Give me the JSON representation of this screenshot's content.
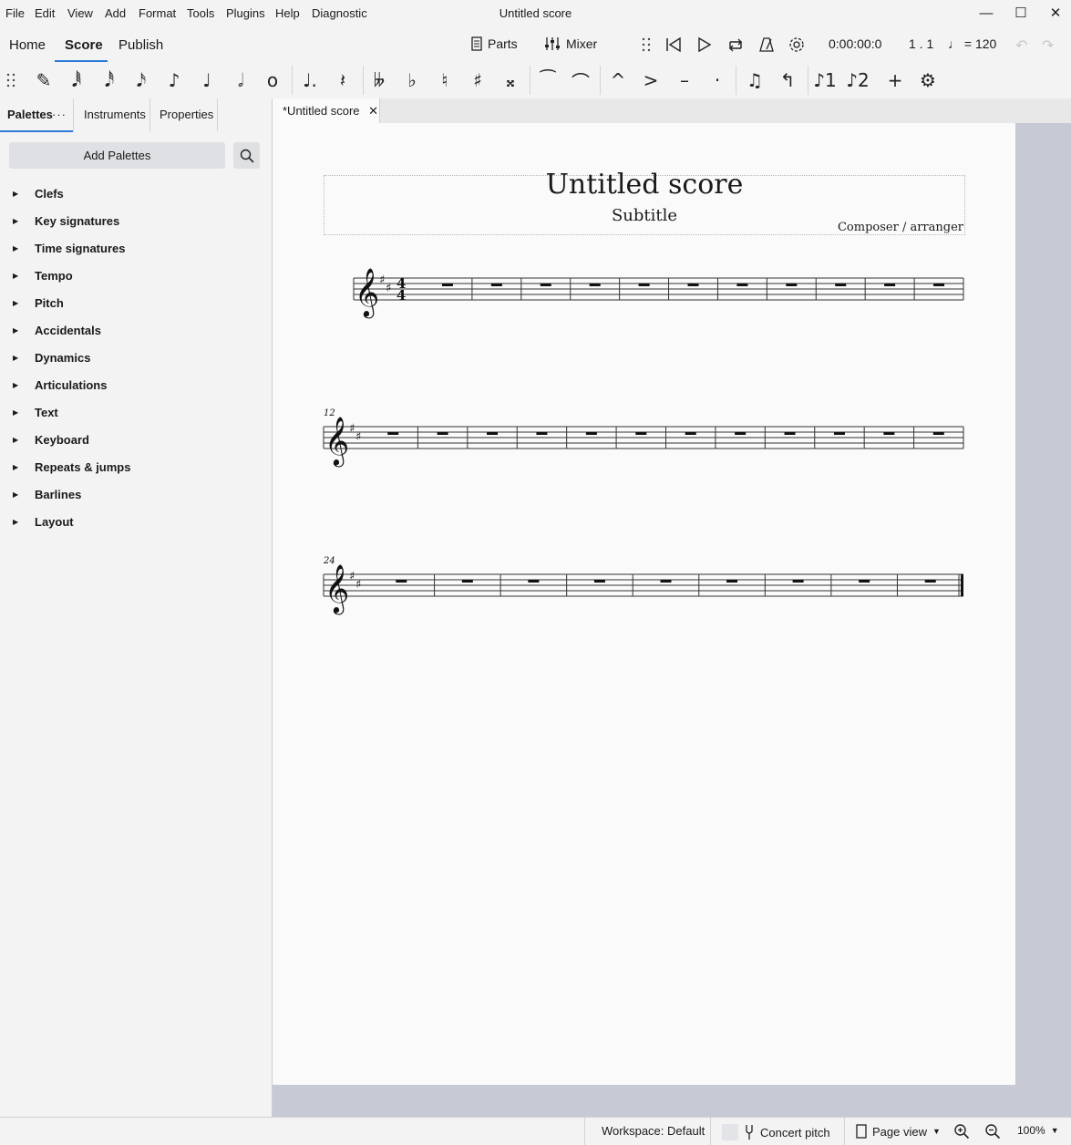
{
  "menu": [
    "File",
    "Edit",
    "View",
    "Add",
    "Format",
    "Tools",
    "Plugins",
    "Help",
    "Diagnostic"
  ],
  "window_title": "Untitled score",
  "window_controls": {
    "minimize": "—",
    "maximize": "☐",
    "close": "✕"
  },
  "nav_tabs": [
    "Home",
    "Score",
    "Publish"
  ],
  "toolbar": {
    "parts_label": "Parts",
    "mixer_label": "Mixer",
    "time": "0:00:00:0",
    "position": "1 . 1",
    "tempo": "♩ = 120"
  },
  "note_tools": [
    {
      "name": "note-input-icon",
      "glyph": "✎"
    },
    {
      "name": "duration-64th-icon",
      "glyph": "𝅘𝅥𝅱"
    },
    {
      "name": "duration-32nd-icon",
      "glyph": "𝅘𝅥𝅰"
    },
    {
      "name": "duration-16th-icon",
      "glyph": "𝅘𝅥𝅯"
    },
    {
      "name": "duration-eighth-icon",
      "glyph": "♪"
    },
    {
      "name": "duration-quarter-icon",
      "glyph": "♩"
    },
    {
      "name": "duration-half-icon",
      "glyph": "𝅗𝅥"
    },
    {
      "name": "duration-whole-icon",
      "glyph": "o"
    },
    {
      "name": "augmentation-dot-icon",
      "glyph": "♩."
    },
    {
      "name": "rest-icon",
      "glyph": "𝄽"
    },
    {
      "name": "double-flat-icon",
      "glyph": "𝄫"
    },
    {
      "name": "flat-icon",
      "glyph": "♭"
    },
    {
      "name": "natural-icon",
      "glyph": "♮"
    },
    {
      "name": "sharp-icon",
      "glyph": "♯"
    },
    {
      "name": "double-sharp-icon",
      "glyph": "𝄪"
    },
    {
      "name": "tie-icon",
      "glyph": "⁀"
    },
    {
      "name": "slur-icon",
      "glyph": "⌒"
    },
    {
      "name": "marcato-icon",
      "glyph": "^"
    },
    {
      "name": "accent-icon",
      "glyph": ">"
    },
    {
      "name": "tenuto-icon",
      "glyph": "–"
    },
    {
      "name": "staccato-icon",
      "glyph": "·"
    },
    {
      "name": "tuplet-icon",
      "glyph": "♫"
    },
    {
      "name": "flip-direction-icon",
      "glyph": "↰"
    },
    {
      "name": "voice-1-icon",
      "glyph": "♪1"
    },
    {
      "name": "voice-2-icon",
      "glyph": "♪2"
    },
    {
      "name": "add-icon",
      "glyph": "+"
    },
    {
      "name": "settings-gear-icon",
      "glyph": "⚙"
    }
  ],
  "panel_tabs": [
    "Palettes",
    "Instruments",
    "Properties"
  ],
  "panel_menu": "···",
  "add_palettes_label": "Add Palettes",
  "palettes": [
    "Clefs",
    "Key signatures",
    "Time signatures",
    "Tempo",
    "Pitch",
    "Accidentals",
    "Dynamics",
    "Articulations",
    "Text",
    "Keyboard",
    "Repeats & jumps",
    "Barlines",
    "Layout"
  ],
  "score_tab": {
    "label": "*Untitled score",
    "close": "✕"
  },
  "score": {
    "title": "Untitled score",
    "subtitle": "Subtitle",
    "composer": "Composer / arranger",
    "time_signature": {
      "top": "4",
      "bottom": "4"
    },
    "key": "2 sharps",
    "systems": [
      {
        "measure_number": "",
        "measures": 11
      },
      {
        "measure_number": "12",
        "measures": 12
      },
      {
        "measure_number": "24",
        "measures": 9
      }
    ]
  },
  "status": {
    "workspace": "Workspace: Default",
    "concert_pitch": "Concert pitch",
    "view_mode": "Page view",
    "zoom": "100%"
  }
}
